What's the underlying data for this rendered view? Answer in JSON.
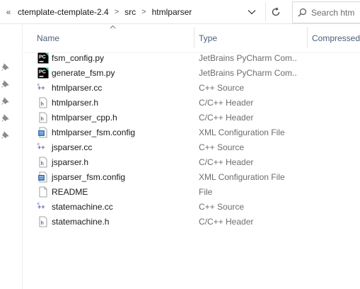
{
  "address": {
    "overflow": "«",
    "crumbs": [
      "ctemplate-ctemplate-2.4",
      "src",
      "htmlparser"
    ],
    "search_placeholder": "Search htm"
  },
  "columns": {
    "name": "Name",
    "type": "Type",
    "compressed": "Compressed"
  },
  "files": [
    {
      "name": "fsm_config.py",
      "type": "JetBrains PyCharm Com...",
      "icon": "pycharm-icon"
    },
    {
      "name": "generate_fsm.py",
      "type": "JetBrains PyCharm Com...",
      "icon": "pycharm-icon"
    },
    {
      "name": "htmlparser.cc",
      "type": "C++ Source",
      "icon": "cpp-source-icon"
    },
    {
      "name": "htmlparser.h",
      "type": "C/C++ Header",
      "icon": "header-file-icon"
    },
    {
      "name": "htmlparser_cpp.h",
      "type": "C/C++ Header",
      "icon": "header-file-icon"
    },
    {
      "name": "htmlparser_fsm.config",
      "type": "XML Configuration File",
      "icon": "xml-config-icon"
    },
    {
      "name": "jsparser.cc",
      "type": "C++ Source",
      "icon": "cpp-source-icon"
    },
    {
      "name": "jsparser.h",
      "type": "C/C++ Header",
      "icon": "header-file-icon"
    },
    {
      "name": "jsparser_fsm.config",
      "type": "XML Configuration File",
      "icon": "xml-config-icon"
    },
    {
      "name": "README",
      "type": "File",
      "icon": "blank-file-icon"
    },
    {
      "name": "statemachine.cc",
      "type": "C++ Source",
      "icon": "cpp-source-icon"
    },
    {
      "name": "statemachine.h",
      "type": "C/C++ Header",
      "icon": "header-file-icon"
    }
  ]
}
